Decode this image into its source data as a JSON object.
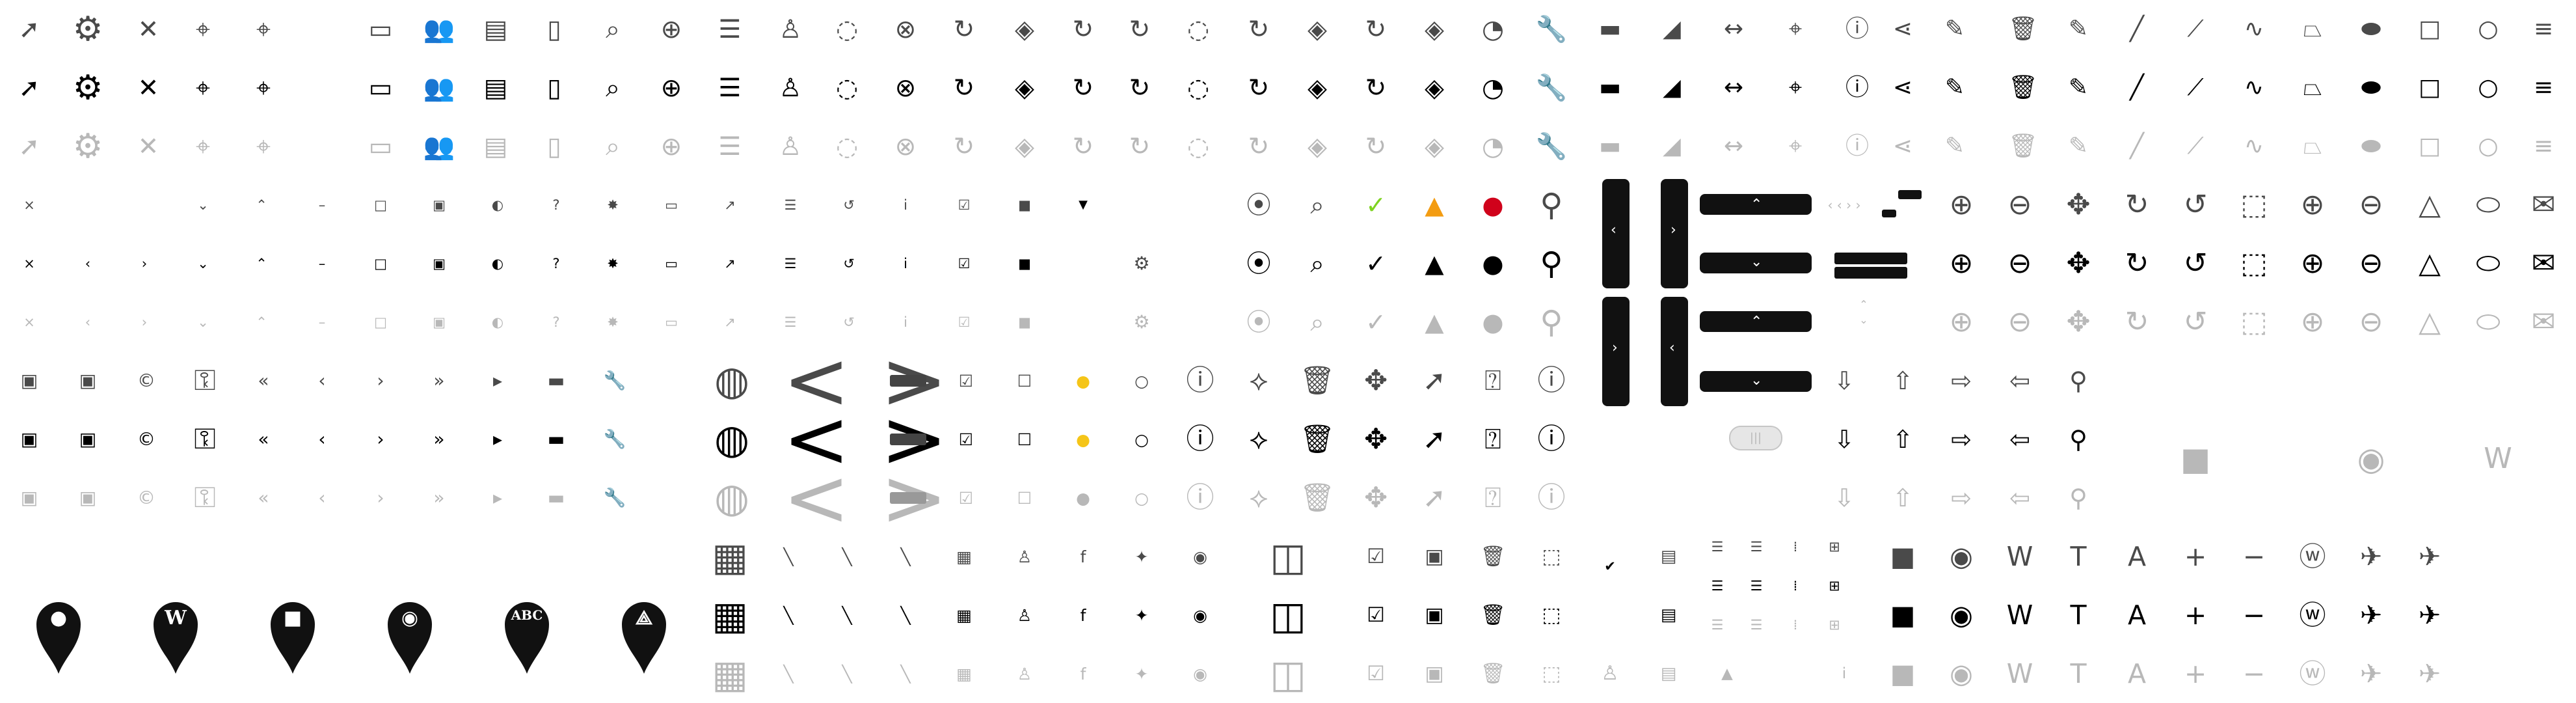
{
  "sprite": {
    "title": "",
    "colors": {
      "normal": "#4a4a4a",
      "hover": "#000000",
      "disabled": "#b8b8b8",
      "warning": "#f39c12",
      "error": "#d0021b",
      "success": "#7ed321",
      "highlight": "#f5c518"
    },
    "icons": {
      "cursor": {
        "glyph": "➚"
      },
      "gear": {
        "glyph": "⚙"
      },
      "close": {
        "glyph": "✕"
      },
      "crosshair": {
        "glyph": "⌖"
      },
      "target": {
        "glyph": "⌖"
      },
      "panorama": {
        "glyph": "▭"
      },
      "users": {
        "glyph": "👥"
      },
      "photos": {
        "glyph": "▤"
      },
      "document": {
        "glyph": "▯"
      },
      "search": {
        "glyph": "⌕"
      },
      "globe": {
        "glyph": "⊕"
      },
      "list": {
        "glyph": "☰"
      },
      "person": {
        "glyph": "♙"
      },
      "circle-dotted": {
        "glyph": "◌"
      },
      "circle-x": {
        "glyph": "⊗"
      },
      "rotate": {
        "glyph": "↻"
      },
      "compass": {
        "glyph": "◈"
      },
      "gauge": {
        "glyph": "◔"
      },
      "wrench": {
        "glyph": "🔧"
      },
      "ruler": {
        "glyph": "▬"
      },
      "ruler-up": {
        "glyph": "◢"
      },
      "measure": {
        "glyph": "↔"
      },
      "info-pin": {
        "glyph": "ⓘ"
      },
      "share": {
        "glyph": "⋖"
      },
      "pencil": {
        "glyph": "✎"
      },
      "trash": {
        "glyph": "🗑"
      },
      "line": {
        "glyph": "╱"
      },
      "polyline": {
        "glyph": "⟋"
      },
      "curve": {
        "glyph": "∿"
      },
      "polygon": {
        "glyph": "⏢"
      },
      "freeform": {
        "glyph": "⬬"
      },
      "square": {
        "glyph": "□"
      },
      "circle": {
        "glyph": "○"
      },
      "hamburger": {
        "glyph": "≡"
      },
      "x-small": {
        "glyph": "×"
      },
      "lt": {
        "glyph": "‹"
      },
      "gt": {
        "glyph": "›"
      },
      "chev-down": {
        "glyph": "⌄"
      },
      "chev-up": {
        "glyph": "⌃"
      },
      "minus": {
        "glyph": "–"
      },
      "window": {
        "glyph": "□"
      },
      "windows": {
        "glyph": "▣"
      },
      "half": {
        "glyph": "◐"
      },
      "question": {
        "glyph": "?"
      },
      "sun": {
        "glyph": "✸"
      },
      "monitor": {
        "glyph": "▭"
      },
      "arrow-ne": {
        "glyph": "↗"
      },
      "refresh": {
        "glyph": "↺"
      },
      "info-i": {
        "glyph": "i"
      },
      "checkbox": {
        "glyph": "☑"
      },
      "filled-square": {
        "glyph": "■"
      },
      "triangle-down": {
        "glyph": "▼"
      },
      "map-pin": {
        "glyph": "⦿"
      },
      "zoom": {
        "glyph": "⌕"
      },
      "check-circle": {
        "glyph": "✓"
      },
      "warning": {
        "glyph": "▲"
      },
      "error": {
        "glyph": "●"
      },
      "map-marker": {
        "glyph": "⚲"
      },
      "comment-flag": {
        "glyph": "▣"
      },
      "save": {
        "glyph": "▣"
      },
      "copyright": {
        "glyph": "©"
      },
      "key": {
        "glyph": "⚿"
      },
      "double-lt": {
        "glyph": "«"
      },
      "double-gt": {
        "glyph": "»"
      },
      "play-small": {
        "glyph": "▸"
      },
      "toolbox": {
        "glyph": "▬"
      },
      "globe-cursor": {
        "glyph": "◍"
      },
      "big-chev-left": {
        "glyph": "<"
      },
      "big-chev-right": {
        "glyph": ">"
      },
      "mini-bar": {
        "glyph": "▬"
      },
      "checkbox-checked": {
        "glyph": "☑"
      },
      "checkbox-empty": {
        "glyph": "☐"
      },
      "radio-yellow": {
        "glyph": "●"
      },
      "radio-empty": {
        "glyph": "○"
      },
      "info-bubble": {
        "glyph": "ⓘ"
      },
      "draw-poly": {
        "glyph": "⟡"
      },
      "delete-poly": {
        "glyph": "🗑"
      },
      "move-poly": {
        "glyph": "✥"
      },
      "select-poly": {
        "glyph": "➚"
      },
      "identify": {
        "glyph": "⍰"
      },
      "map-info": {
        "glyph": "ⓘ"
      },
      "arrow-down": {
        "glyph": "⇩"
      },
      "arrow-up": {
        "glyph": "⇧"
      },
      "arrow-right": {
        "glyph": "⇨"
      },
      "arrow-left": {
        "glyph": "⇦"
      },
      "location-pin": {
        "glyph": "⚲"
      },
      "zoom-in": {
        "glyph": "⊕"
      },
      "zoom-out": {
        "glyph": "⊖"
      },
      "pan-globe": {
        "glyph": "✥"
      },
      "rotate-cw": {
        "glyph": "↻"
      },
      "rotate-ccw": {
        "glyph": "↺"
      },
      "zoom-box": {
        "glyph": "⬚"
      },
      "triangle": {
        "glyph": "△"
      },
      "ellipse": {
        "glyph": "⬭"
      },
      "mail": {
        "glyph": "✉"
      },
      "video": {
        "glyph": "■"
      },
      "camera": {
        "glyph": "◉"
      },
      "wikipedia": {
        "glyph": "W"
      },
      "tile-map": {
        "glyph": "▦"
      },
      "layer-stack": {
        "glyph": "▤"
      },
      "pen-line": {
        "glyph": "╲"
      },
      "calendar": {
        "glyph": "▦"
      },
      "facebook": {
        "glyph": "f"
      },
      "twitter": {
        "glyph": "✦"
      },
      "eye": {
        "glyph": "◉"
      },
      "world-map": {
        "glyph": "◫"
      },
      "check-square": {
        "glyph": "☑"
      },
      "copy-square": {
        "glyph": "▣"
      },
      "resize-box": {
        "glyph": "⬚"
      },
      "checkmark": {
        "glyph": "✔"
      },
      "doc-search": {
        "glyph": "▤"
      },
      "list-view": {
        "glyph": "☰"
      },
      "list-bullets": {
        "glyph": "☰"
      },
      "grid-dots": {
        "glyph": "⁞"
      },
      "grid-squares": {
        "glyph": "⊞"
      },
      "text-tool": {
        "glyph": "T"
      },
      "letter-a": {
        "glyph": "A"
      },
      "plus-square": {
        "glyph": "+"
      },
      "minus-square": {
        "glyph": "−"
      },
      "wiki-pin": {
        "glyph": "ⓦ"
      },
      "airport": {
        "glyph": "✈"
      },
      "helicopter": {
        "glyph": "✈"
      },
      "pin-dot": {
        "glyph": "●"
      },
      "pin-wiki": {
        "glyph": "W"
      },
      "pin-video": {
        "glyph": "■"
      },
      "pin-camera": {
        "glyph": "◉"
      },
      "pin-abc": {
        "glyph": "ABC"
      },
      "pin-pdf": {
        "glyph": "⟁"
      }
    },
    "pill_chevrons": {
      "left": "‹",
      "right": "›",
      "up": "⌃",
      "down": "⌄",
      "strip": "‹ ‹ › ›",
      "toggle": "|||"
    }
  }
}
